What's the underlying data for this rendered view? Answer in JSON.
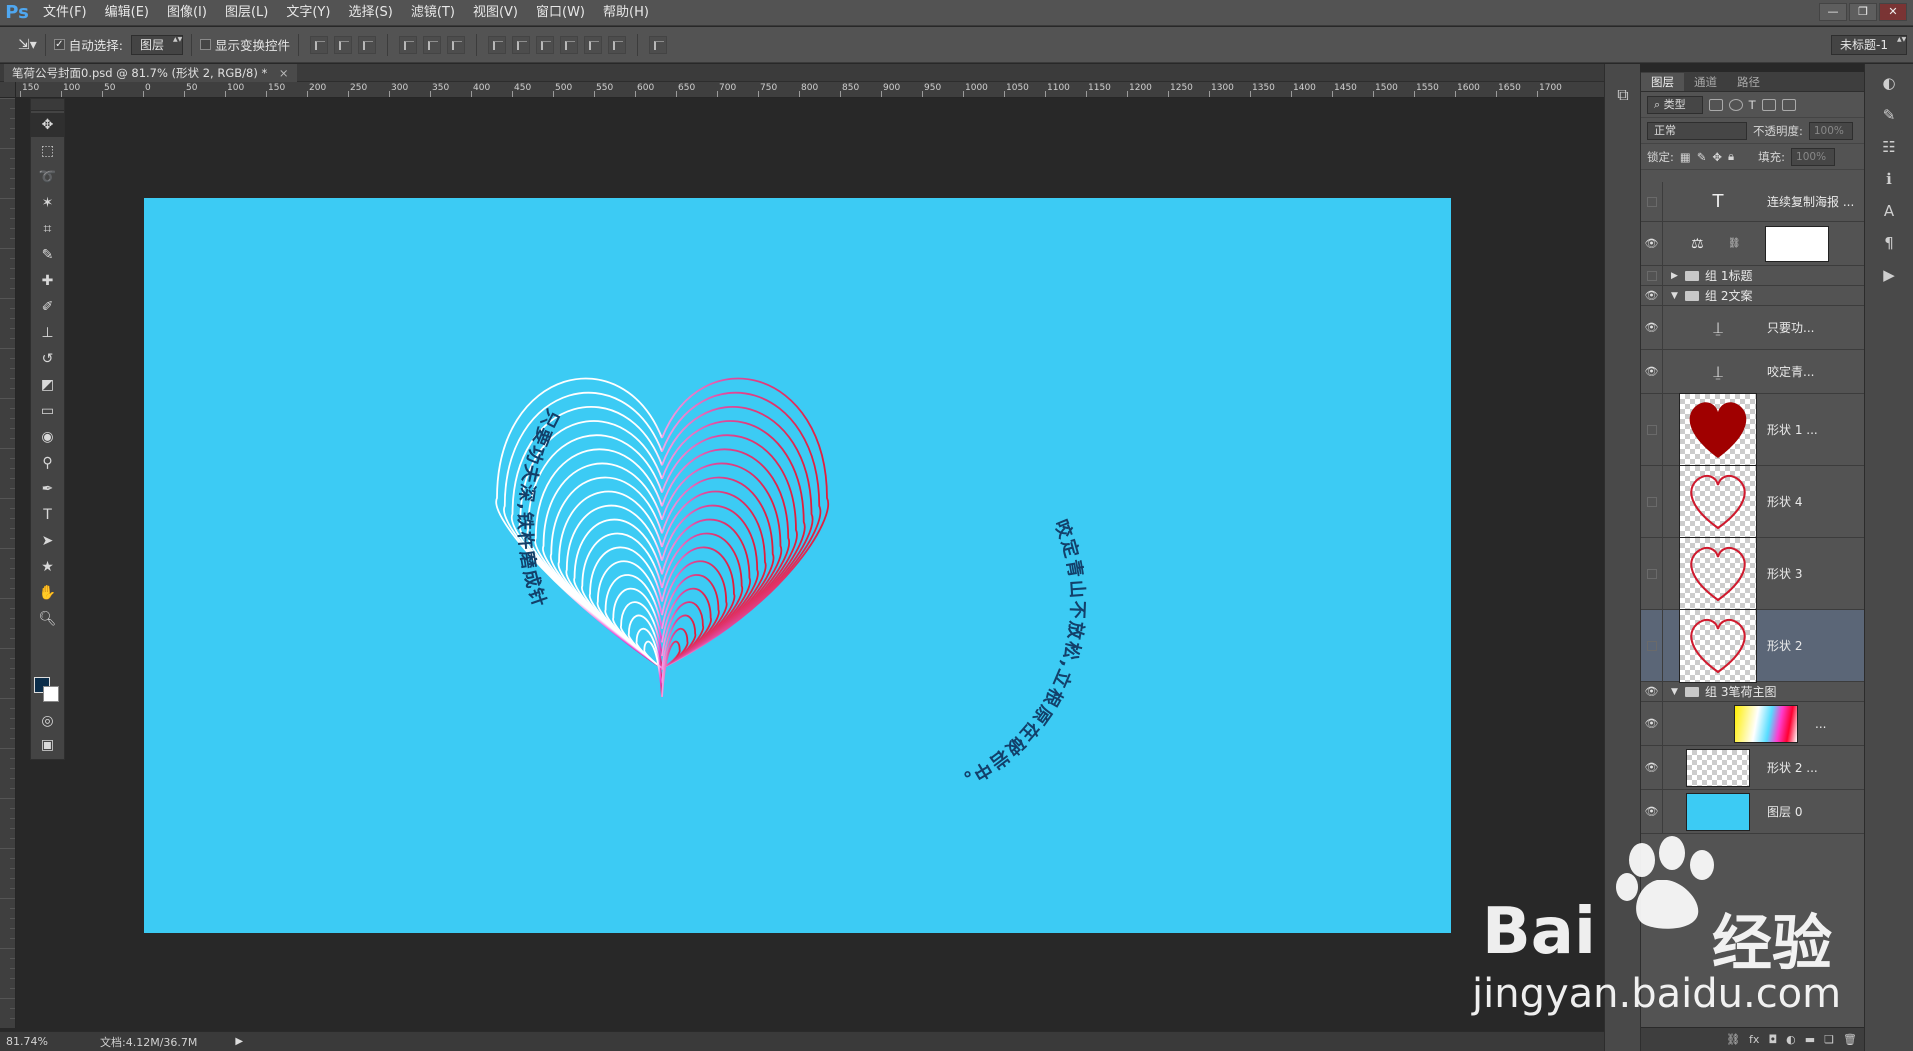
{
  "app": {
    "logo": "Ps"
  },
  "menu": [
    "文件(F)",
    "编辑(E)",
    "图像(I)",
    "图层(L)",
    "文字(Y)",
    "选择(S)",
    "滤镜(T)",
    "视图(V)",
    "窗口(W)",
    "帮助(H)"
  ],
  "options_bar": {
    "auto_select_label": "自动选择:",
    "auto_select_value": "图层",
    "show_transform_label": "显示变换控件",
    "workspace": "未标题-1"
  },
  "document": {
    "tab_title": "笔荷公号封面0.psd @ 81.7% (形状 2, RGB/8) *",
    "close_glyph": "×"
  },
  "ruler_labels": [
    "150",
    "100",
    "50",
    "0",
    "50",
    "100",
    "150",
    "200",
    "250",
    "300",
    "350",
    "400",
    "450",
    "500",
    "550",
    "600",
    "650",
    "700",
    "750",
    "800",
    "850",
    "900",
    "950",
    "1000",
    "1050",
    "1100",
    "1150",
    "1200",
    "1250",
    "1300",
    "1350",
    "1400",
    "1450",
    "1500",
    "1550",
    "1600",
    "1650",
    "1700"
  ],
  "canvas": {
    "background": "#3ccbf4",
    "text_left": "只要功夫深,铁杵磨成针。",
    "text_right": "咬定青山不放松,立根原在破岩中。",
    "text_color": "#13406a"
  },
  "status": {
    "zoom": "81.74%",
    "doc": "文档:4.12M/36.7M",
    "arrow": "▶"
  },
  "panel": {
    "tabs": [
      "图层",
      "通道",
      "路径"
    ],
    "filter_label": "类型",
    "blend_mode": "正常",
    "opacity_label": "不透明度:",
    "opacity_value": "100%",
    "lock_label": "锁定:",
    "fill_label": "填充:",
    "fill_value": "100%"
  },
  "layers": [
    {
      "name": "连续复制海报 ...",
      "kind": "text",
      "visible": false
    },
    {
      "name": "",
      "kind": "adjustment",
      "visible": true
    },
    {
      "name": "组 1标题",
      "kind": "group-closed",
      "visible": false
    },
    {
      "name": "组 2文案",
      "kind": "group-open",
      "visible": true
    },
    {
      "name": "只要功...",
      "kind": "text-path",
      "visible": true
    },
    {
      "name": "咬定青...",
      "kind": "text-path",
      "visible": true
    },
    {
      "name": "形状 1 ...",
      "kind": "shape-filled",
      "visible": false
    },
    {
      "name": "形状 4",
      "kind": "shape-outline",
      "visible": false
    },
    {
      "name": "形状 3",
      "kind": "shape-outline",
      "visible": false
    },
    {
      "name": "形状 2",
      "kind": "shape-outline",
      "visible": false,
      "selected": true
    },
    {
      "name": "组 3笔荷主图",
      "kind": "group-open",
      "visible": true
    },
    {
      "name": "...",
      "kind": "gradient",
      "visible": true
    },
    {
      "name": "形状 2 ...",
      "kind": "shape-faint",
      "visible": true
    },
    {
      "name": "图层 0",
      "kind": "blue",
      "visible": true
    }
  ],
  "colors": {
    "accent": "#3ccbf4",
    "heart_red": "#e01e3a",
    "heart_pink": "#f03cd2",
    "shape_fill": "#a00000"
  },
  "watermark": {
    "brand": "Bai",
    "brand2": "经验",
    "url": "jingyan.baidu.com"
  }
}
